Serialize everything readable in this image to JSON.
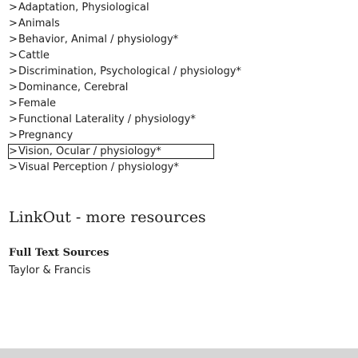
{
  "mesh_terms": [
    {
      "label": "Adaptation, Physiological"
    },
    {
      "label": "Animals"
    },
    {
      "label": "Behavior, Animal / physiology*"
    },
    {
      "label": "Cattle"
    },
    {
      "label": "Discrimination, Psychological / physiology*"
    },
    {
      "label": "Dominance, Cerebral"
    },
    {
      "label": "Female"
    },
    {
      "label": "Functional Laterality / physiology*"
    },
    {
      "label": "Pregnancy"
    },
    {
      "label": "Vision, Ocular / physiology*"
    },
    {
      "label": "Visual Perception / physiology*"
    }
  ],
  "chevron_glyph": ">",
  "linkout": {
    "title": "LinkOut - more resources",
    "full_text_heading": "Full Text Sources",
    "providers": [
      "Taylor & Francis"
    ]
  }
}
